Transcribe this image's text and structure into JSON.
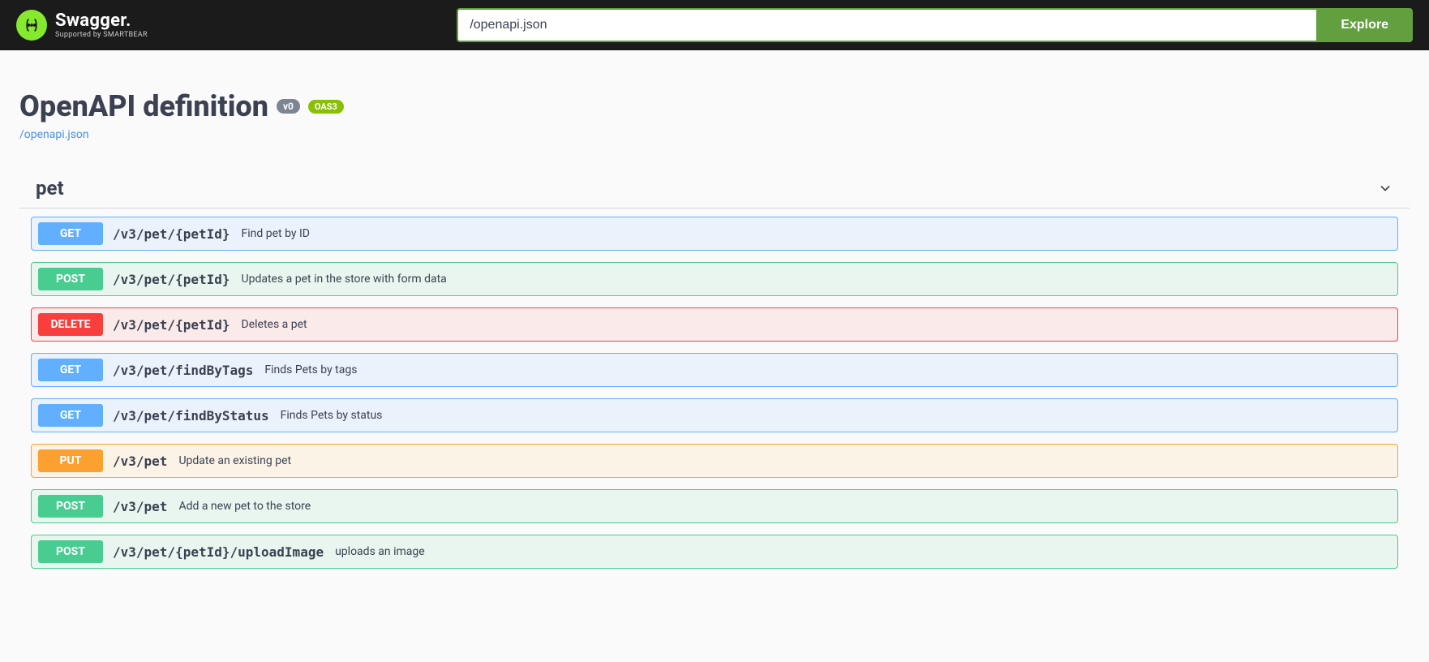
{
  "topbar": {
    "brand_name": "Swagger.",
    "brand_tag": "Supported by SMARTBEAR",
    "spec_value": "/openapi.json",
    "explore_label": "Explore"
  },
  "header": {
    "title": "OpenAPI definition",
    "version_badge": "v0",
    "oas_badge": "OAS3",
    "spec_link": "/openapi.json"
  },
  "tag": {
    "name": "pet"
  },
  "operations": [
    {
      "method": "GET",
      "method_class": "get",
      "path": "/v3/pet/{petId}",
      "summary": "Find pet by ID"
    },
    {
      "method": "POST",
      "method_class": "post",
      "path": "/v3/pet/{petId}",
      "summary": "Updates a pet in the store with form data"
    },
    {
      "method": "DELETE",
      "method_class": "delete",
      "path": "/v3/pet/{petId}",
      "summary": "Deletes a pet"
    },
    {
      "method": "GET",
      "method_class": "get",
      "path": "/v3/pet/findByTags",
      "summary": "Finds Pets by tags"
    },
    {
      "method": "GET",
      "method_class": "get",
      "path": "/v3/pet/findByStatus",
      "summary": "Finds Pets by status"
    },
    {
      "method": "PUT",
      "method_class": "put",
      "path": "/v3/pet",
      "summary": "Update an existing pet"
    },
    {
      "method": "POST",
      "method_class": "post",
      "path": "/v3/pet",
      "summary": "Add a new pet to the store"
    },
    {
      "method": "POST",
      "method_class": "post",
      "path": "/v3/pet/{petId}/uploadImage",
      "summary": "uploads an image"
    }
  ]
}
